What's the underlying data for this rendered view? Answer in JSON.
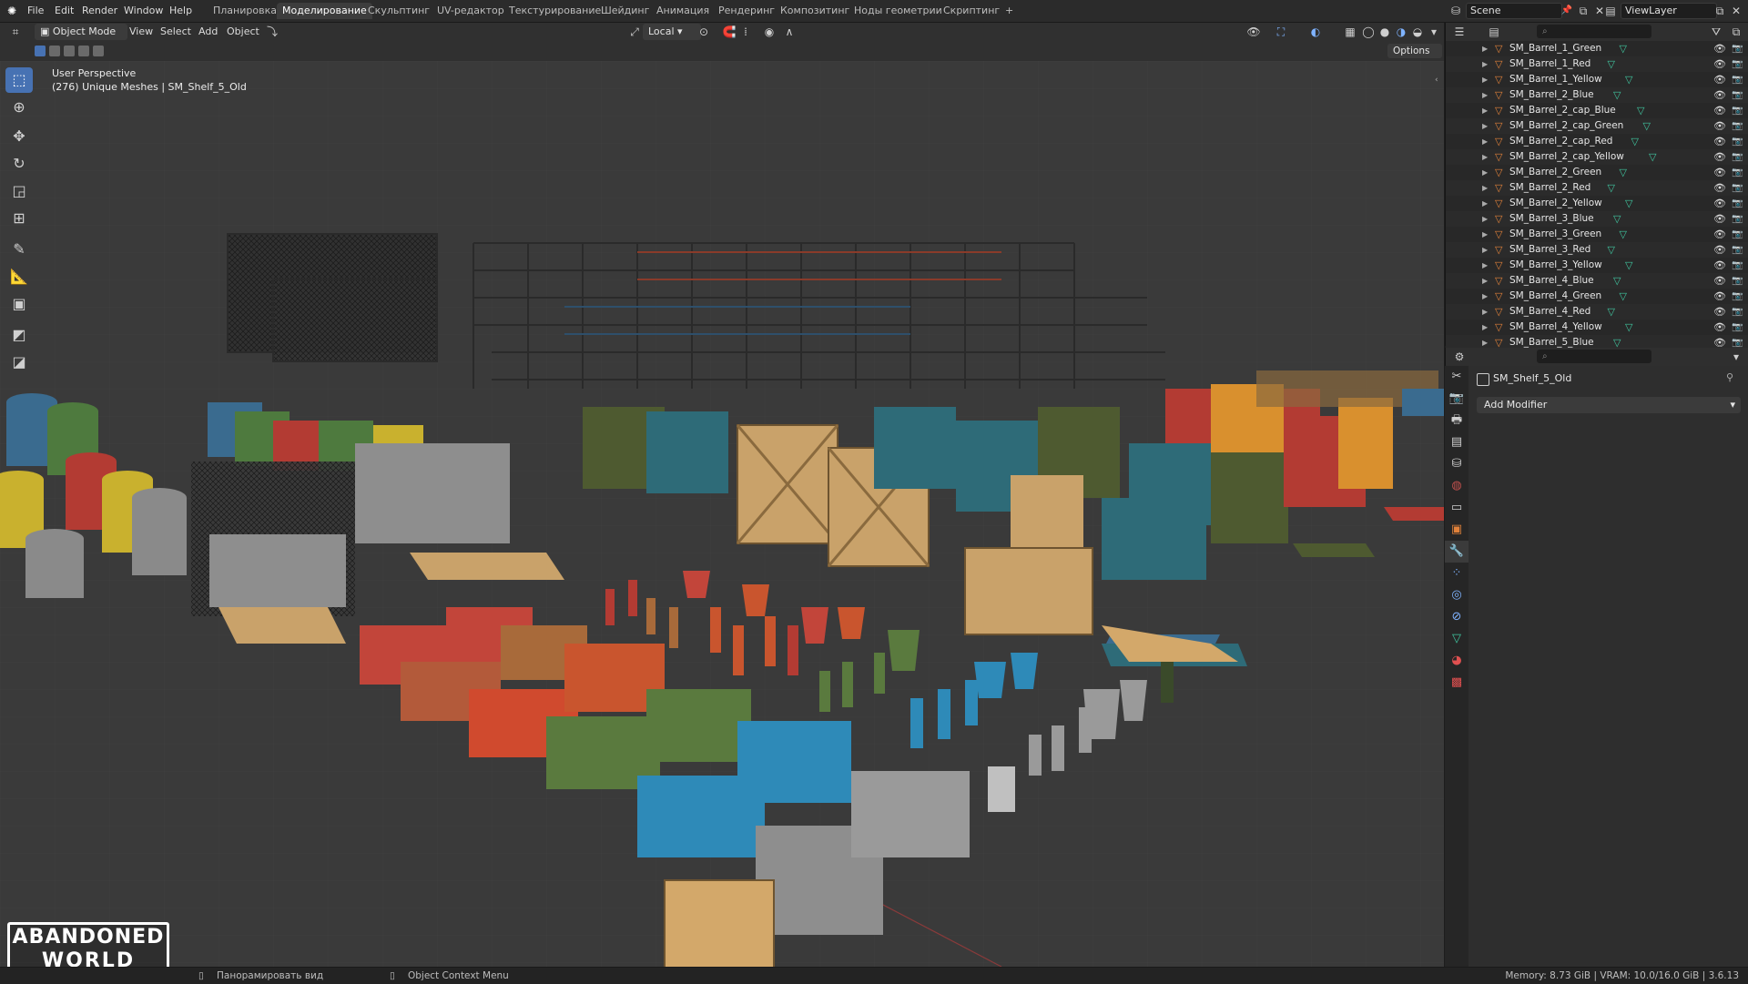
{
  "top_menu": {
    "items": [
      "File",
      "Edit",
      "Render",
      "Window",
      "Help"
    ],
    "workspaces": [
      "Планировка",
      "Моделирование",
      "Скульптинг",
      "UV-редактор",
      "Текстурирование",
      "Шейдинг",
      "Анимация",
      "Рендеринг",
      "Композитинг",
      "Ноды геометрии",
      "Скриптинг"
    ],
    "active_workspace": "Моделирование",
    "add_tab": "+",
    "scene": "Scene",
    "view_layer": "ViewLayer"
  },
  "viewport_header": {
    "mode": "Object Mode",
    "menus": [
      "View",
      "Select",
      "Add",
      "Object"
    ],
    "transform_orientation": "Local",
    "options": "Options"
  },
  "viewport_overlay": {
    "perspective": "User Perspective",
    "info": "(276) Unique Meshes | SM_Shelf_5_Old"
  },
  "watermark": {
    "line1": "ABANDONED",
    "line2": "WORLD"
  },
  "outliner": {
    "items": [
      "SM_Barrel_1_Green",
      "SM_Barrel_1_Red",
      "SM_Barrel_1_Yellow",
      "SM_Barrel_2_Blue",
      "SM_Barrel_2_cap_Blue",
      "SM_Barrel_2_cap_Green",
      "SM_Barrel_2_cap_Red",
      "SM_Barrel_2_cap_Yellow",
      "SM_Barrel_2_Green",
      "SM_Barrel_2_Red",
      "SM_Barrel_2_Yellow",
      "SM_Barrel_3_Blue",
      "SM_Barrel_3_Green",
      "SM_Barrel_3_Red",
      "SM_Barrel_3_Yellow",
      "SM_Barrel_4_Blue",
      "SM_Barrel_4_Green",
      "SM_Barrel_4_Red",
      "SM_Barrel_4_Yellow",
      "SM_Barrel_5_Blue"
    ]
  },
  "properties": {
    "object_name": "SM_Shelf_5_Old",
    "add_modifier": "Add Modifier"
  },
  "status_bar": {
    "pan_view": "Панорамировать вид",
    "context_menu": "Object Context Menu",
    "memory": "Memory: 8.73 GiB | VRAM: 10.0/16.0 GiB | 3.6.13"
  },
  "colors": {
    "accent": "#4772b3",
    "mesh_icon": "#e0813a",
    "vertex_icon": "#40c7a0",
    "viewport_bg": "#3a3a3a"
  }
}
